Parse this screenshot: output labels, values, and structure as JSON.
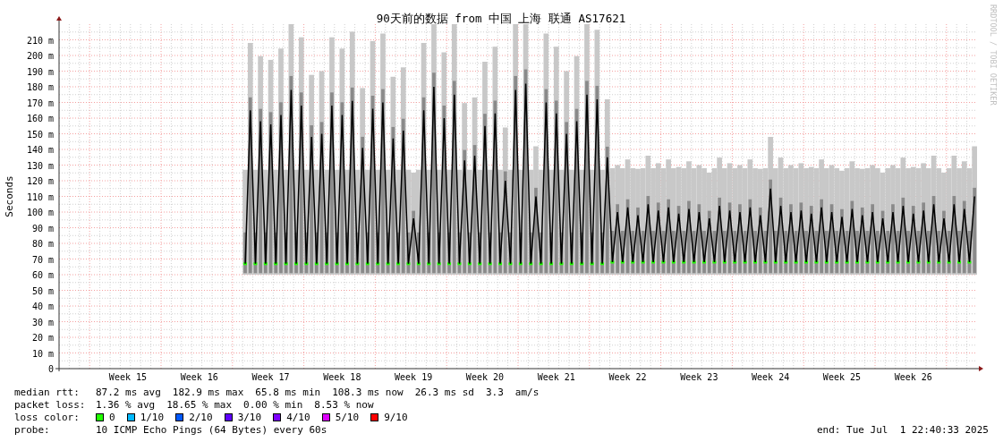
{
  "chart": {
    "credit": "RRDTOOL / TOBI OETIKER",
    "week_labels": [
      "Week 15",
      "Week 16",
      "Week 17",
      "Week 18",
      "Week 19",
      "Week 20",
      "Week 21",
      "Week 22",
      "Week 23",
      "Week 24",
      "Week 25",
      "Week 26"
    ],
    "chart_data": {
      "type": "line",
      "title": "90天前的数据 from 中国 上海 联通 AS17621",
      "ylabel": "Seconds",
      "grid": true,
      "ylim": [
        0,
        220
      ],
      "yticks": [
        {
          "value": 0,
          "label": "0"
        },
        {
          "value": 10,
          "label": "10 m"
        },
        {
          "value": 20,
          "label": "20 m"
        },
        {
          "value": 30,
          "label": "30 m"
        },
        {
          "value": 40,
          "label": "40 m"
        },
        {
          "value": 50,
          "label": "50 m"
        },
        {
          "value": 60,
          "label": "60 m"
        },
        {
          "value": 70,
          "label": "70 m"
        },
        {
          "value": 80,
          "label": "80 m"
        },
        {
          "value": 90,
          "label": "90 m"
        },
        {
          "value": 100,
          "label": "100 m"
        },
        {
          "value": 110,
          "label": "110 m"
        },
        {
          "value": 120,
          "label": "120 m"
        },
        {
          "value": 130,
          "label": "130 m"
        },
        {
          "value": 140,
          "label": "140 m"
        },
        {
          "value": 150,
          "label": "150 m"
        },
        {
          "value": 160,
          "label": "160 m"
        },
        {
          "value": 170,
          "label": "170 m"
        },
        {
          "value": 180,
          "label": "180 m"
        },
        {
          "value": 190,
          "label": "190 m"
        },
        {
          "value": 200,
          "label": "200 m"
        },
        {
          "value": 210,
          "label": "210 m"
        }
      ],
      "series": [
        {
          "color": "#000000",
          "values": [
            null,
            null,
            null,
            null,
            null,
            null,
            null,
            null,
            null,
            null,
            null,
            null,
            null,
            null,
            null,
            null,
            null,
            null,
            null,
            null,
            null,
            null,
            null,
            null,
            null,
            null,
            null,
            null,
            null,
            null,
            null,
            null,
            null,
            null,
            null,
            null,
            67,
            165,
            67,
            158,
            67,
            156,
            67,
            162,
            67,
            178,
            67,
            168,
            67,
            148,
            67,
            150,
            67,
            168,
            67,
            162,
            67,
            171,
            67,
            141,
            67,
            166,
            67,
            170,
            67,
            147,
            67,
            152,
            67,
            96,
            67,
            165,
            67,
            180,
            67,
            160,
            67,
            175,
            67,
            133,
            67,
            136,
            67,
            155,
            67,
            163,
            67,
            120,
            67,
            178,
            67,
            182,
            67,
            110,
            67,
            170,
            67,
            163,
            67,
            150,
            67,
            158,
            67,
            175,
            67,
            172,
            67,
            135,
            68,
            100,
            68,
            103,
            68,
            98,
            68,
            105,
            68,
            101,
            68,
            103,
            68,
            99,
            68,
            102,
            68,
            100,
            68,
            96,
            68,
            104,
            68,
            101,
            68,
            100,
            68,
            103,
            68,
            98,
            68,
            115,
            68,
            104,
            68,
            100,
            68,
            101,
            68,
            99,
            68,
            103,
            68,
            100,
            68,
            97,
            68,
            102,
            68,
            98,
            68,
            100,
            68,
            96,
            68,
            100,
            68,
            104,
            68,
            99,
            68,
            101,
            68,
            105,
            68,
            96,
            68,
            105,
            68,
            102,
            68,
            110
          ]
        }
      ]
    }
  },
  "legend": {
    "median_rtt": {
      "label": "median rtt:",
      "stats": [
        "87.2 ms avg",
        "182.9 ms max",
        "65.8 ms min",
        "108.3 ms now",
        "26.3 ms sd",
        "3.3",
        "am/s"
      ]
    },
    "packet_loss": {
      "label": "packet loss:",
      "stats": [
        "1.36 % avg",
        "18.65 % max",
        "0.00 % min",
        "8.53 % now"
      ]
    },
    "loss_color": {
      "label": "loss color:",
      "items": [
        {
          "label": "0",
          "color": "#22ff00"
        },
        {
          "label": "1/10",
          "color": "#00b8ff"
        },
        {
          "label": "2/10",
          "color": "#0059ff"
        },
        {
          "label": "3/10",
          "color": "#5e00ff"
        },
        {
          "label": "4/10",
          "color": "#7e00ff"
        },
        {
          "label": "5/10",
          "color": "#dd00ff"
        },
        {
          "label": "9/10",
          "color": "#ff0000"
        }
      ]
    },
    "probe": {
      "label": "probe:",
      "text": "10 ICMP Echo Pings (64 Bytes) every 60s",
      "end": "end: Tue Jul  1 22:40:33 2025"
    }
  }
}
